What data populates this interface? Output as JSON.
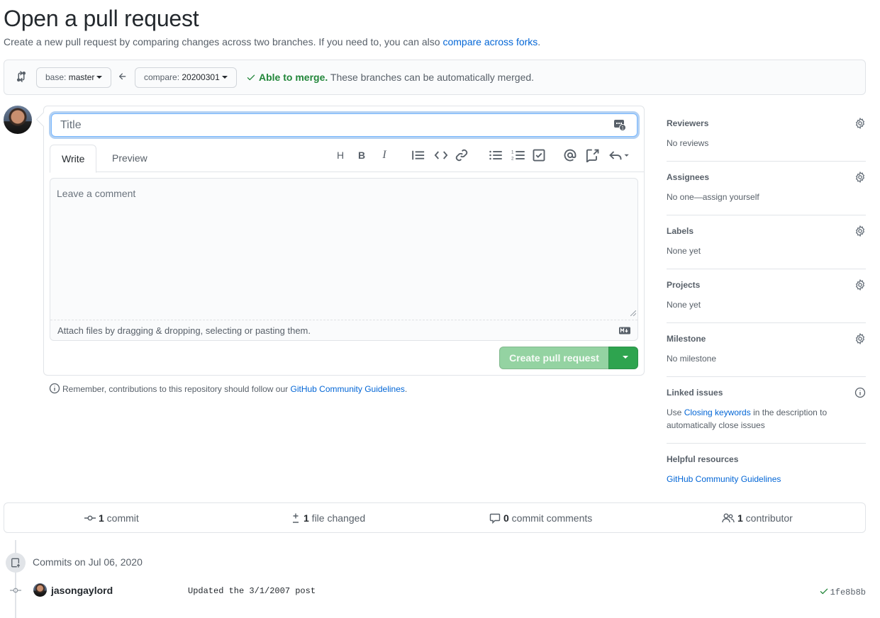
{
  "page": {
    "title": "Open a pull request",
    "subtitle_text": "Create a new pull request by comparing changes across two branches. If you need to, you can also ",
    "subtitle_link": "compare across forks",
    "subtitle_end": "."
  },
  "compare": {
    "base_prefix": "base: ",
    "base_branch": "master",
    "compare_prefix": "compare: ",
    "compare_branch": "20200301",
    "merge_status": "Able to merge.",
    "merge_message": " These branches can be automatically merged."
  },
  "form": {
    "title_placeholder": "Title",
    "tab_write": "Write",
    "tab_preview": "Preview",
    "comment_placeholder": "Leave a comment",
    "attach_text": "Attach files by dragging & dropping, selecting or pasting them.",
    "create_button": "Create pull request",
    "remember_text": "Remember, contributions to this repository should follow our ",
    "remember_link": "GitHub Community Guidelines",
    "remember_end": "."
  },
  "toolbar": {
    "heading": "H",
    "bold": "B",
    "italic": "I"
  },
  "sidebar": {
    "reviewers": {
      "label": "Reviewers",
      "value": "No reviews"
    },
    "assignees": {
      "label": "Assignees",
      "value": "No one—assign yourself"
    },
    "labels": {
      "label": "Labels",
      "value": "None yet"
    },
    "projects": {
      "label": "Projects",
      "value": "None yet"
    },
    "milestone": {
      "label": "Milestone",
      "value": "No milestone"
    },
    "linked_issues": {
      "label": "Linked issues",
      "value_pre": "Use ",
      "value_link": "Closing keywords",
      "value_post": " in the description to automatically close issues"
    },
    "helpful": {
      "label": "Helpful resources",
      "link": "GitHub Community Guidelines"
    }
  },
  "stats": {
    "commits_count": "1",
    "commits_label": " commit",
    "files_count": "1",
    "files_label": " file changed",
    "comments_count": "0",
    "comments_label": " commit comments",
    "contributors_count": "1",
    "contributors_label": " contributor"
  },
  "commits": {
    "date_header": "Commits on Jul 06, 2020",
    "items": [
      {
        "author": "jasongaylord",
        "message": "Updated the 3/1/2007 post",
        "sha": "1fe8b8b"
      }
    ]
  },
  "colors": {
    "link": "#0366d6",
    "success": "#22863a",
    "button_green": "#2ea44f",
    "button_green_disabled": "#94d3a2"
  }
}
